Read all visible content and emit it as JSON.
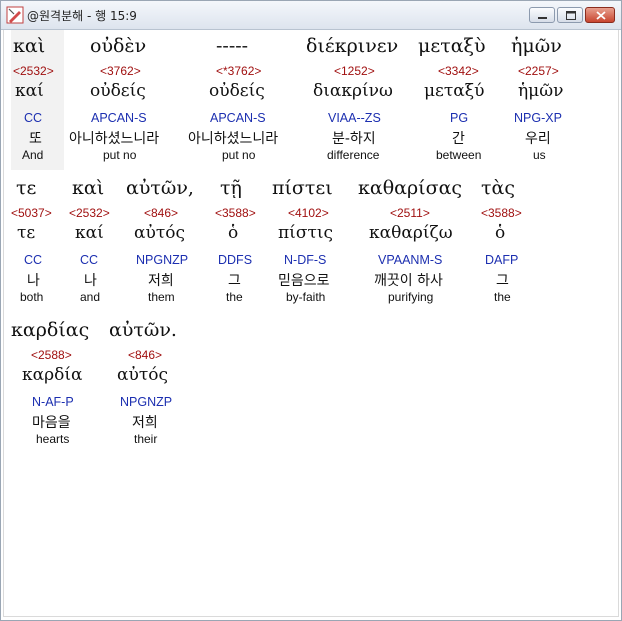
{
  "window": {
    "title": "@원격분해 - 행 15:9",
    "buttons": {
      "minimize": "minimize",
      "maximize": "maximize",
      "close": "close"
    },
    "icons": {
      "app": "pen-icon"
    }
  },
  "colors": {
    "strong": "#a01010",
    "parse": "#1c2fb0",
    "text": "#111111"
  },
  "lines": [
    {
      "words": [
        {
          "greek": "καὶ",
          "strong": "<2532>",
          "lemma": "καί",
          "parse": "CC",
          "korean": "또",
          "english": "And"
        },
        {
          "greek": "οὐδὲν",
          "strong": "<3762>",
          "lemma": "οὐδείς",
          "parse": "APCAN-S",
          "korean": "아니하셨느니라",
          "english": "put no"
        },
        {
          "greek": "-----",
          "strong": "<*3762>",
          "lemma": "οὐδείς",
          "parse": "APCAN-S",
          "korean": "아니하셨느니라",
          "english": "put no"
        },
        {
          "greek": "διέκρινεν",
          "strong": "<1252>",
          "lemma": "διακρίνω",
          "parse": "VIAA--ZS",
          "korean": "분-하지",
          "english": "difference"
        },
        {
          "greek": "μεταξὺ",
          "strong": "<3342>",
          "lemma": "μεταξύ",
          "parse": "PG",
          "korean": "간",
          "english": "between"
        },
        {
          "greek": "ἡμῶν",
          "strong": "<2257>",
          "lemma": "ἡμῶν",
          "parse": "NPG-XP",
          "korean": "우리",
          "english": "us"
        }
      ]
    },
    {
      "words": [
        {
          "greek": "τε",
          "strong": "<5037>",
          "lemma": "τε",
          "parse": "CC",
          "korean": "나",
          "english": "both"
        },
        {
          "greek": "καὶ",
          "strong": "<2532>",
          "lemma": "καί",
          "parse": "CC",
          "korean": "나",
          "english": "and"
        },
        {
          "greek": "αὐτῶν,",
          "strong": "<846>",
          "lemma": "αὐτός",
          "parse": "NPGNZP",
          "korean": "저희",
          "english": "them"
        },
        {
          "greek": "τῇ",
          "strong": "<3588>",
          "lemma": "ὁ",
          "parse": "DDFS",
          "korean": "그",
          "english": "the"
        },
        {
          "greek": "πίστει",
          "strong": "<4102>",
          "lemma": "πίστις",
          "parse": "N-DF-S",
          "korean": "믿음으로",
          "english": "by-faith"
        },
        {
          "greek": "καθαρίσας",
          "strong": "<2511>",
          "lemma": "καθαρίζω",
          "parse": "VPAANM-S",
          "korean": "깨끗이 하사",
          "english": "purifying"
        },
        {
          "greek": "τὰς",
          "strong": "<3588>",
          "lemma": "ὁ",
          "parse": "DAFP",
          "korean": "그",
          "english": "the"
        }
      ]
    },
    {
      "words": [
        {
          "greek": "καρδίας",
          "strong": "<2588>",
          "lemma": "καρδία",
          "parse": "N-AF-P",
          "korean": "마음을",
          "english": "hearts"
        },
        {
          "greek": "αὐτῶν.",
          "strong": "<846>",
          "lemma": "αὐτός",
          "parse": "NPGNZP",
          "korean": "저희",
          "english": "their"
        }
      ]
    }
  ]
}
